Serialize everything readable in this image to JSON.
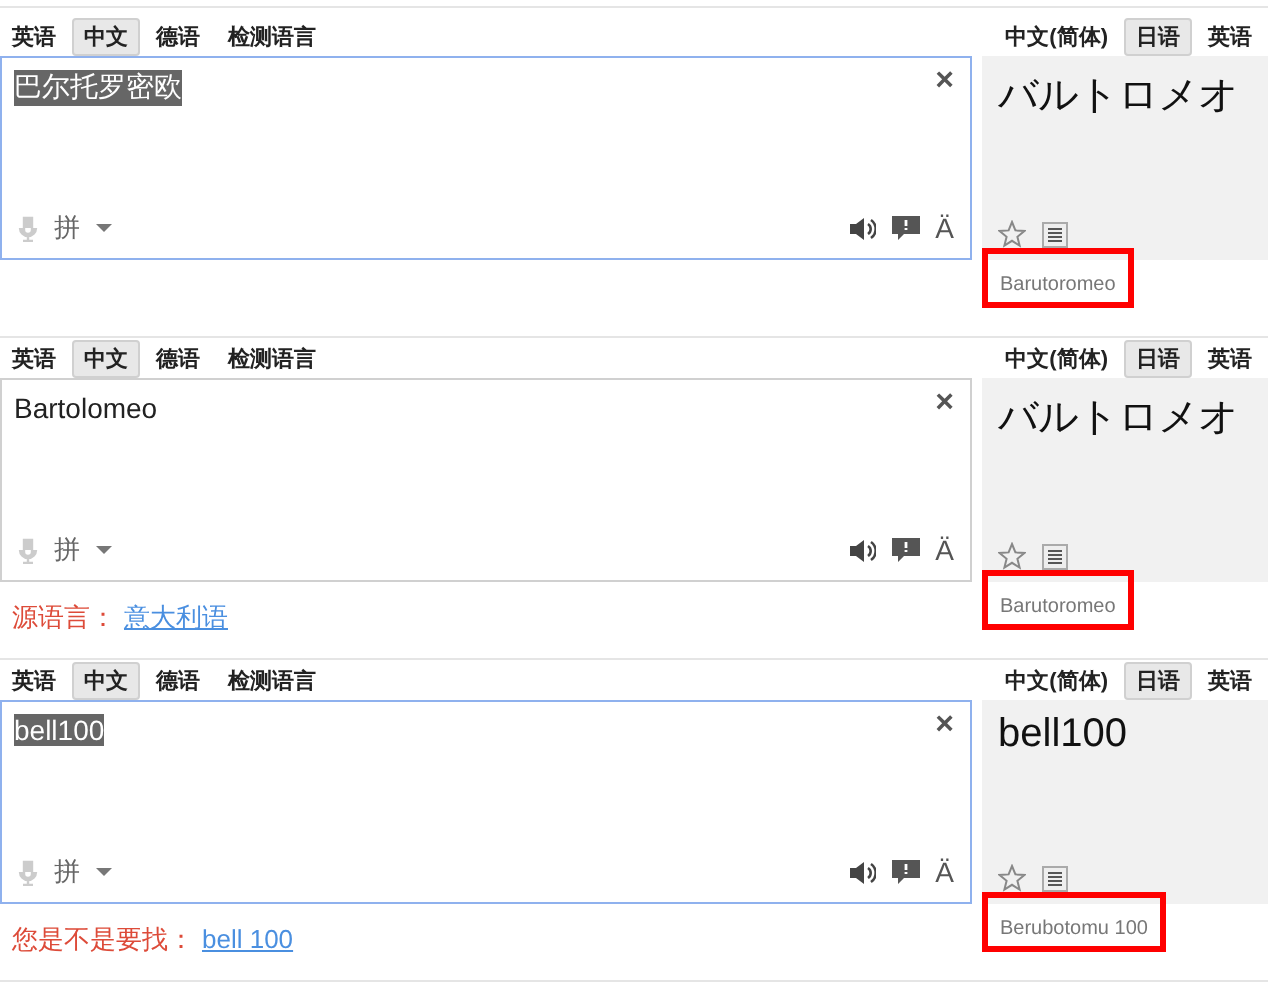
{
  "panels": [
    {
      "source_tabs": [
        {
          "label": "英语",
          "selected": false
        },
        {
          "label": "中文",
          "selected": true
        },
        {
          "label": "德语",
          "selected": false
        },
        {
          "label": "检测语言",
          "selected": false
        }
      ],
      "target_tabs": [
        {
          "label": "中文(简体)",
          "selected": false
        },
        {
          "label": "日语",
          "selected": true
        },
        {
          "label": "英语",
          "selected": false
        }
      ],
      "input": {
        "value": "巴尔托罗密欧",
        "text_selected": true,
        "focused": true
      },
      "close": "×",
      "ime": "拼",
      "font_toggle": "Ä",
      "translation": "バルトロメオ",
      "romanization": "Barutoromeo",
      "marked": true
    },
    {
      "source_tabs": [
        {
          "label": "英语",
          "selected": false
        },
        {
          "label": "中文",
          "selected": true
        },
        {
          "label": "德语",
          "selected": false
        },
        {
          "label": "检测语言",
          "selected": false
        }
      ],
      "target_tabs": [
        {
          "label": "中文(简体)",
          "selected": false
        },
        {
          "label": "日语",
          "selected": true
        },
        {
          "label": "英语",
          "selected": false
        }
      ],
      "input": {
        "value": "Bartolomeo",
        "text_selected": false,
        "focused": false
      },
      "close": "×",
      "ime": "拼",
      "font_toggle": "Ä",
      "translation": "バルトロメオ",
      "romanization": "Barutoromeo",
      "marked": true,
      "notice": {
        "label": "源语言：",
        "link": "意大利语"
      }
    },
    {
      "source_tabs": [
        {
          "label": "英语",
          "selected": false
        },
        {
          "label": "中文",
          "selected": true
        },
        {
          "label": "德语",
          "selected": false
        },
        {
          "label": "检测语言",
          "selected": false
        }
      ],
      "target_tabs": [
        {
          "label": "中文(简体)",
          "selected": false
        },
        {
          "label": "日语",
          "selected": true
        },
        {
          "label": "英语",
          "selected": false
        }
      ],
      "input": {
        "value": "bell100",
        "text_selected": true,
        "focused": true
      },
      "close": "×",
      "ime": "拼",
      "font_toggle": "Ä",
      "translation": "bell100",
      "romanization": "Berubotomu 100",
      "marked": true,
      "notice": {
        "label": "您是不是要找：",
        "link": "bell 100"
      }
    }
  ]
}
